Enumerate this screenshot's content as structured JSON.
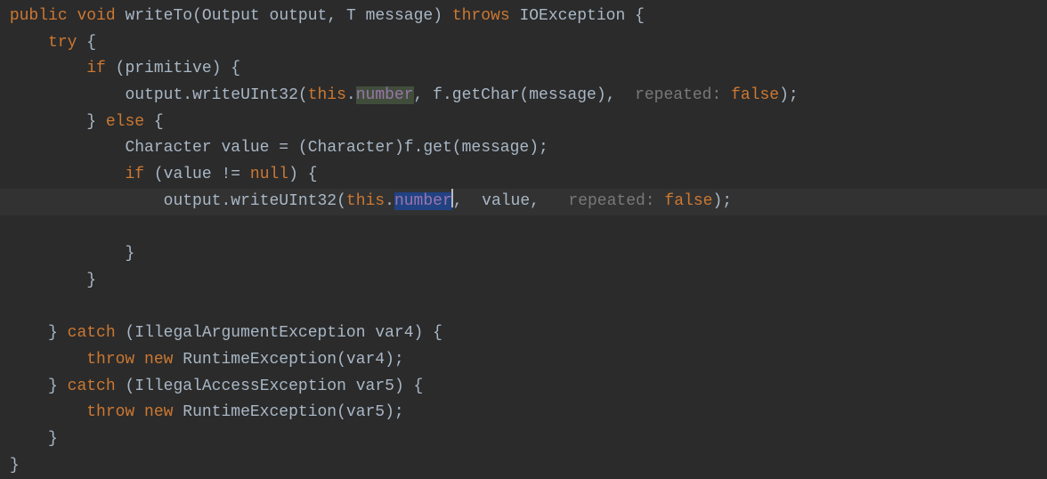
{
  "code": {
    "l1": {
      "kw_public": "public",
      "kw_void": "void",
      "method": "writeTo",
      "p1_type": "Output",
      "p1_name": "output",
      "p2_type": "T",
      "p2_name": "message",
      "kw_throws": "throws",
      "exc": "IOException",
      "brace": "{"
    },
    "l2": {
      "kw_try": "try",
      "brace": "{"
    },
    "l3": {
      "kw_if": "if",
      "cond": "primitive",
      "brace": "{"
    },
    "l4": {
      "obj": "output",
      "call": "writeUInt32",
      "kw_this": "this",
      "field": "number",
      "obj2": "f",
      "call2": "getChar",
      "arg": "message",
      "hint": "repeated:",
      "val": "false"
    },
    "l5": {
      "close": "}",
      "kw_else": "else",
      "brace": "{"
    },
    "l6": {
      "type": "Character",
      "var": "value",
      "eq": "=",
      "cast": "Character",
      "obj": "f",
      "call": "get",
      "arg": "message"
    },
    "l7": {
      "kw_if": "if",
      "var": "value",
      "op": "!=",
      "kw_null": "null",
      "brace": "{"
    },
    "l8": {
      "obj": "output",
      "call": "writeUInt32",
      "kw_this": "this",
      "field": "number",
      "arg": "value",
      "hint": "repeated:",
      "val": "false"
    },
    "l9": {
      "close": "}"
    },
    "l10": {
      "close": "}"
    },
    "l12": {
      "close": "}",
      "kw_catch": "catch",
      "type": "IllegalArgumentException",
      "var": "var4",
      "brace": "{"
    },
    "l13": {
      "kw_throw": "throw",
      "kw_new": "new",
      "type": "RuntimeException",
      "arg": "var4"
    },
    "l14": {
      "close": "}",
      "kw_catch": "catch",
      "type": "IllegalAccessException",
      "var": "var5",
      "brace": "{"
    },
    "l15": {
      "kw_throw": "throw",
      "kw_new": "new",
      "type": "RuntimeException",
      "arg": "var5"
    },
    "l16": {
      "close": "}"
    },
    "l17": {
      "close": "}"
    }
  }
}
